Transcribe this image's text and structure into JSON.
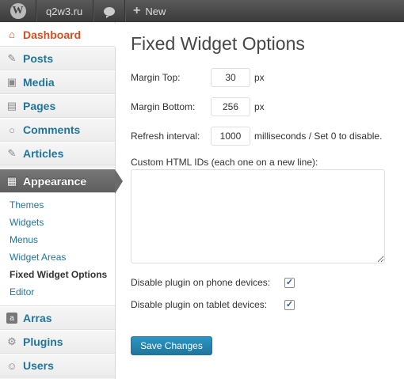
{
  "adminbar": {
    "wp_logo": "W",
    "site_name": "q2w3.ru",
    "comments_icon": "comment-bubble",
    "new_label": "New"
  },
  "sidebar": {
    "dashboard": "Dashboard",
    "posts": "Posts",
    "media": "Media",
    "pages": "Pages",
    "comments": "Comments",
    "articles": "Articles",
    "appearance": "Appearance",
    "submenu": [
      "Themes",
      "Widgets",
      "Menus",
      "Widget Areas",
      "Fixed Widget Options",
      "Editor"
    ],
    "arras": "Arras",
    "arras_icon_letter": "a",
    "plugins": "Plugins",
    "users": "Users"
  },
  "main": {
    "title": "Fixed Widget Options",
    "margin_top_label": "Margin Top:",
    "margin_top_value": "30",
    "margin_top_unit": "px",
    "margin_bottom_label": "Margin Bottom:",
    "margin_bottom_value": "256",
    "margin_bottom_unit": "px",
    "refresh_label": "Refresh interval:",
    "refresh_value": "1000",
    "refresh_unit": "milliseconds / Set 0 to disable.",
    "html_ids_label": "Custom HTML IDs (each one on a new line):",
    "html_ids_value": "",
    "disable_phone_label": "Disable plugin on phone devices:",
    "disable_phone_checked": true,
    "disable_tablet_label": "Disable plugin on tablet devices:",
    "disable_tablet_checked": true,
    "save_label": "Save Changes"
  },
  "colors": {
    "adminbar_bg": "#464646",
    "link": "#21759b",
    "current": "#d54e21",
    "button": "#21759b"
  }
}
